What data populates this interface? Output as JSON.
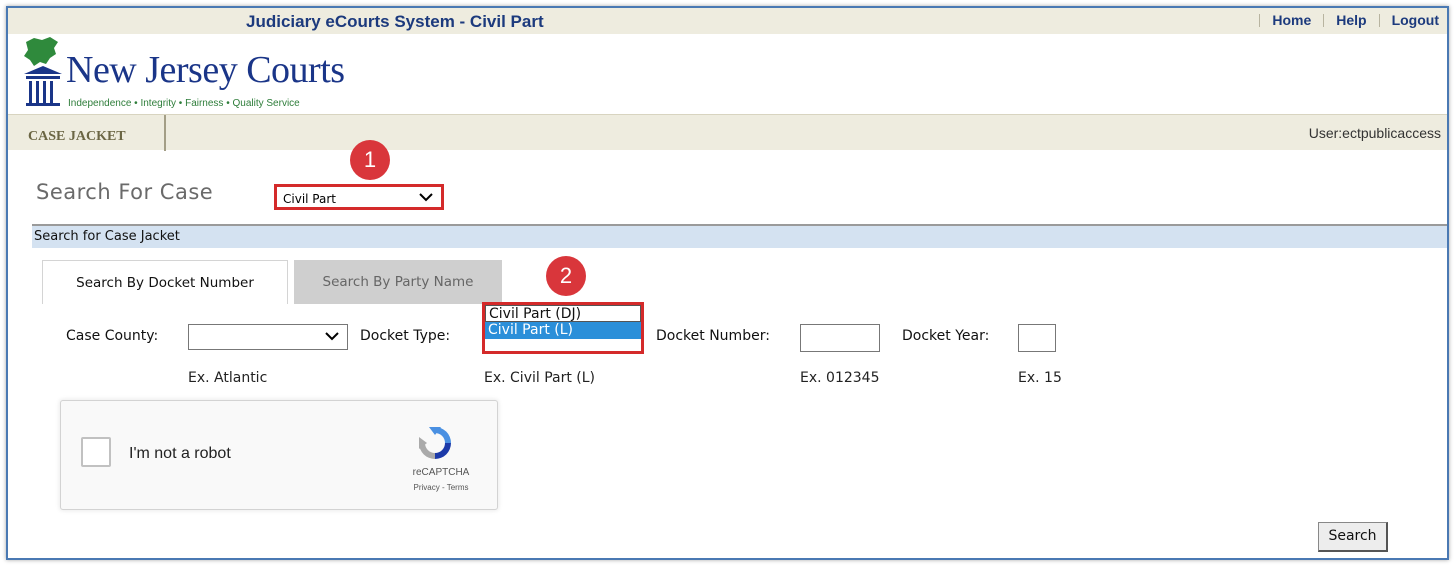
{
  "header": {
    "app_title": "Judiciary eCourts System - Civil Part",
    "links": {
      "home": "Home",
      "help": "Help",
      "logout": "Logout"
    },
    "logo_name": "New Jersey Courts",
    "logo_tagline": "Independence • Integrity • Fairness • Quality Service"
  },
  "nav": {
    "active_tab": "CASE JACKET",
    "user": "User:ectpublicaccess"
  },
  "search": {
    "title": "Search For Case",
    "scope_value": "Civil Part",
    "section_title": "Search for Case Jacket",
    "tabs": {
      "docket": "Search By Docket Number",
      "party": "Search By Party Name"
    }
  },
  "annotations": {
    "marker1": "1",
    "marker2": "2",
    "color": "#d42a2a"
  },
  "form": {
    "case_county_label": "Case County:",
    "case_county_hint": "Ex. Atlantic",
    "docket_type_label": "Docket Type:",
    "docket_type_hint": "Ex. Civil Part (L)",
    "docket_type_options": [
      "Civil Part (DJ)",
      "Civil Part (L)"
    ],
    "docket_number_label": "Docket Number:",
    "docket_number_hint": "Ex. 012345",
    "docket_year_label": "Docket Year:",
    "docket_year_hint": "Ex. 15"
  },
  "captcha": {
    "label": "I'm not a robot",
    "brand": "reCAPTCHA",
    "links": "Privacy - Terms"
  },
  "actions": {
    "search": "Search"
  }
}
